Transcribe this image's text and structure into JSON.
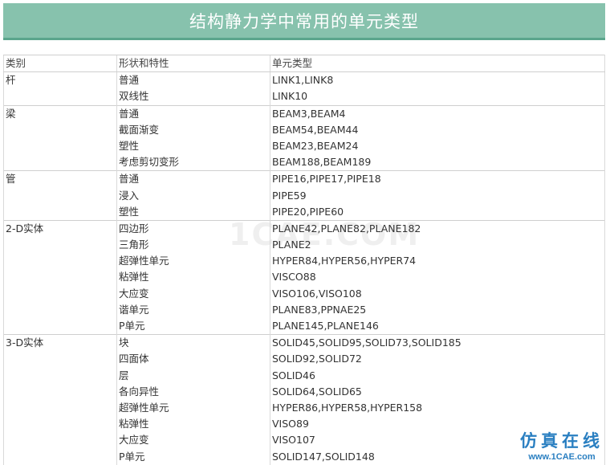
{
  "title": "结构静力学中常用的单元类型",
  "headers": [
    "类别",
    "形状和特性",
    "单元类型"
  ],
  "groups": [
    {
      "category": "杆",
      "rows": [
        [
          "普通",
          "LINK1,LINK8"
        ],
        [
          "双线性",
          "LINK10"
        ]
      ]
    },
    {
      "category": "梁",
      "rows": [
        [
          "普通",
          "BEAM3,BEAM4"
        ],
        [
          "截面渐变",
          "BEAM54,BEAM44"
        ],
        [
          "塑性",
          "BEAM23,BEAM24"
        ],
        [
          "考虑剪切变形",
          "BEAM188,BEAM189"
        ]
      ]
    },
    {
      "category": "管",
      "rows": [
        [
          "普通",
          "PIPE16,PIPE17,PIPE18"
        ],
        [
          "浸入",
          "PIPE59"
        ],
        [
          "塑性",
          "PIPE20,PIPE60"
        ]
      ]
    },
    {
      "category": "2-D实体",
      "rows": [
        [
          "四边形",
          "PLANE42,PLANE82,PLANE182"
        ],
        [
          "三角形",
          "PLANE2"
        ],
        [
          "超弹性单元",
          "HYPER84,HYPER56,HYPER74"
        ],
        [
          "粘弹性",
          "VISCO88"
        ],
        [
          "大应变",
          "VISO106,VISO108"
        ],
        [
          "谐单元",
          "PLANE83,PPNAE25"
        ],
        [
          "P单元",
          "PLANE145,PLANE146"
        ]
      ]
    },
    {
      "category": "3-D实体",
      "rows": [
        [
          "块",
          "SOLID45,SOLID95,SOLID73,SOLID185"
        ],
        [
          "四面体",
          "SOLID92,SOLID72"
        ],
        [
          "层",
          "SOLID46"
        ],
        [
          "各向异性",
          "SOLID64,SOLID65"
        ],
        [
          "超弹性单元",
          "HYPER86,HYPER58,HYPER158"
        ],
        [
          "粘弹性",
          "VISO89"
        ],
        [
          "大应变",
          "VISO107"
        ],
        [
          "P单元",
          "SOLID147,SOLID148"
        ]
      ]
    }
  ],
  "watermark": "1CAE.COM",
  "logo": {
    "text": "仿真在线",
    "url": "www.1CAE.com"
  }
}
